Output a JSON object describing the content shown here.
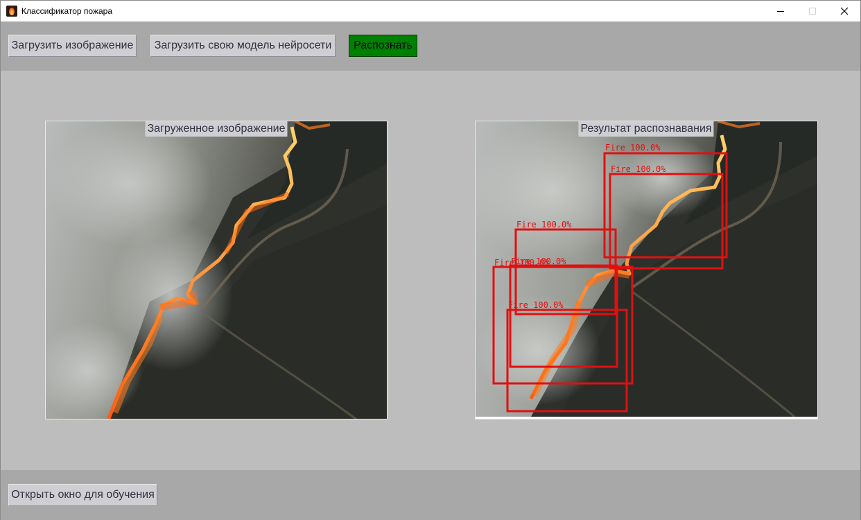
{
  "window": {
    "title": "Классификатор пожара",
    "icon": "fire-app-icon"
  },
  "toolbar": {
    "load_image_label": "Загрузить изображение",
    "load_model_label": "Загрузить свою модель нейросети",
    "recognize_label": "Распознать",
    "recognize_color": "#008000"
  },
  "left_panel": {
    "caption": "Загруженное изображение"
  },
  "right_panel": {
    "caption": "Результат распознавания",
    "box_color": "#e01010",
    "detections": [
      {
        "label": "Fire 100.0%"
      },
      {
        "label": "Fire 100.0%"
      },
      {
        "label": "Fire 100.0%"
      },
      {
        "label": "Fire 100.0%"
      },
      {
        "label": "Fire 100.0%"
      },
      {
        "label": "Fire 100.0%"
      }
    ]
  },
  "bottom": {
    "open_training_label": "Открыть окно для обучения"
  }
}
